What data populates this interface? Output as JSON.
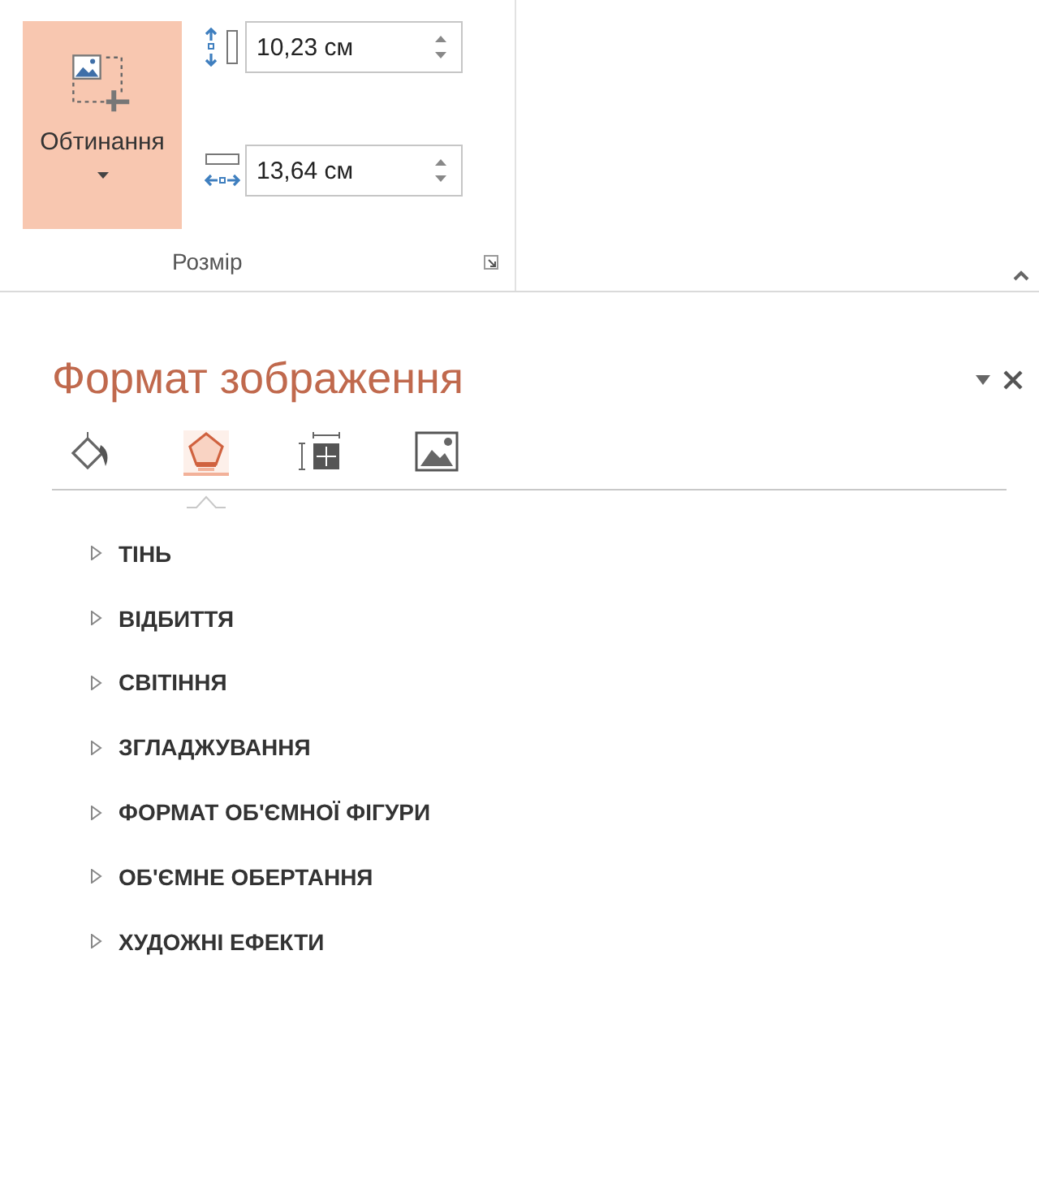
{
  "ribbon": {
    "crop_button": {
      "label": "Обтинання",
      "selected": true
    },
    "size_fields": [
      {
        "kind": "height",
        "value": "10,23 см"
      },
      {
        "kind": "width",
        "value": "13,64 см"
      }
    ],
    "group_label": "Розмір"
  },
  "pane": {
    "title": "Формат зображення",
    "tabs": [
      {
        "kind": "fill",
        "selected": false
      },
      {
        "kind": "effects",
        "selected": true
      },
      {
        "kind": "layout",
        "selected": false
      },
      {
        "kind": "picture",
        "selected": false
      }
    ],
    "sections": [
      {
        "label": "ТІНЬ",
        "expanded": false
      },
      {
        "label": "ВІДБИТТЯ",
        "expanded": false
      },
      {
        "label": "СВІТІННЯ",
        "expanded": false
      },
      {
        "label": "ЗГЛАДЖУВАННЯ",
        "expanded": false
      },
      {
        "label": "ФОРМАТ ОБ'ЄМНОЇ ФІГУРИ",
        "expanded": false
      },
      {
        "label": "ОБ'ЄМНЕ ОБЕРТАННЯ",
        "expanded": false
      },
      {
        "label": "ХУДОЖНІ ЕФЕКТИ",
        "expanded": false
      }
    ]
  }
}
